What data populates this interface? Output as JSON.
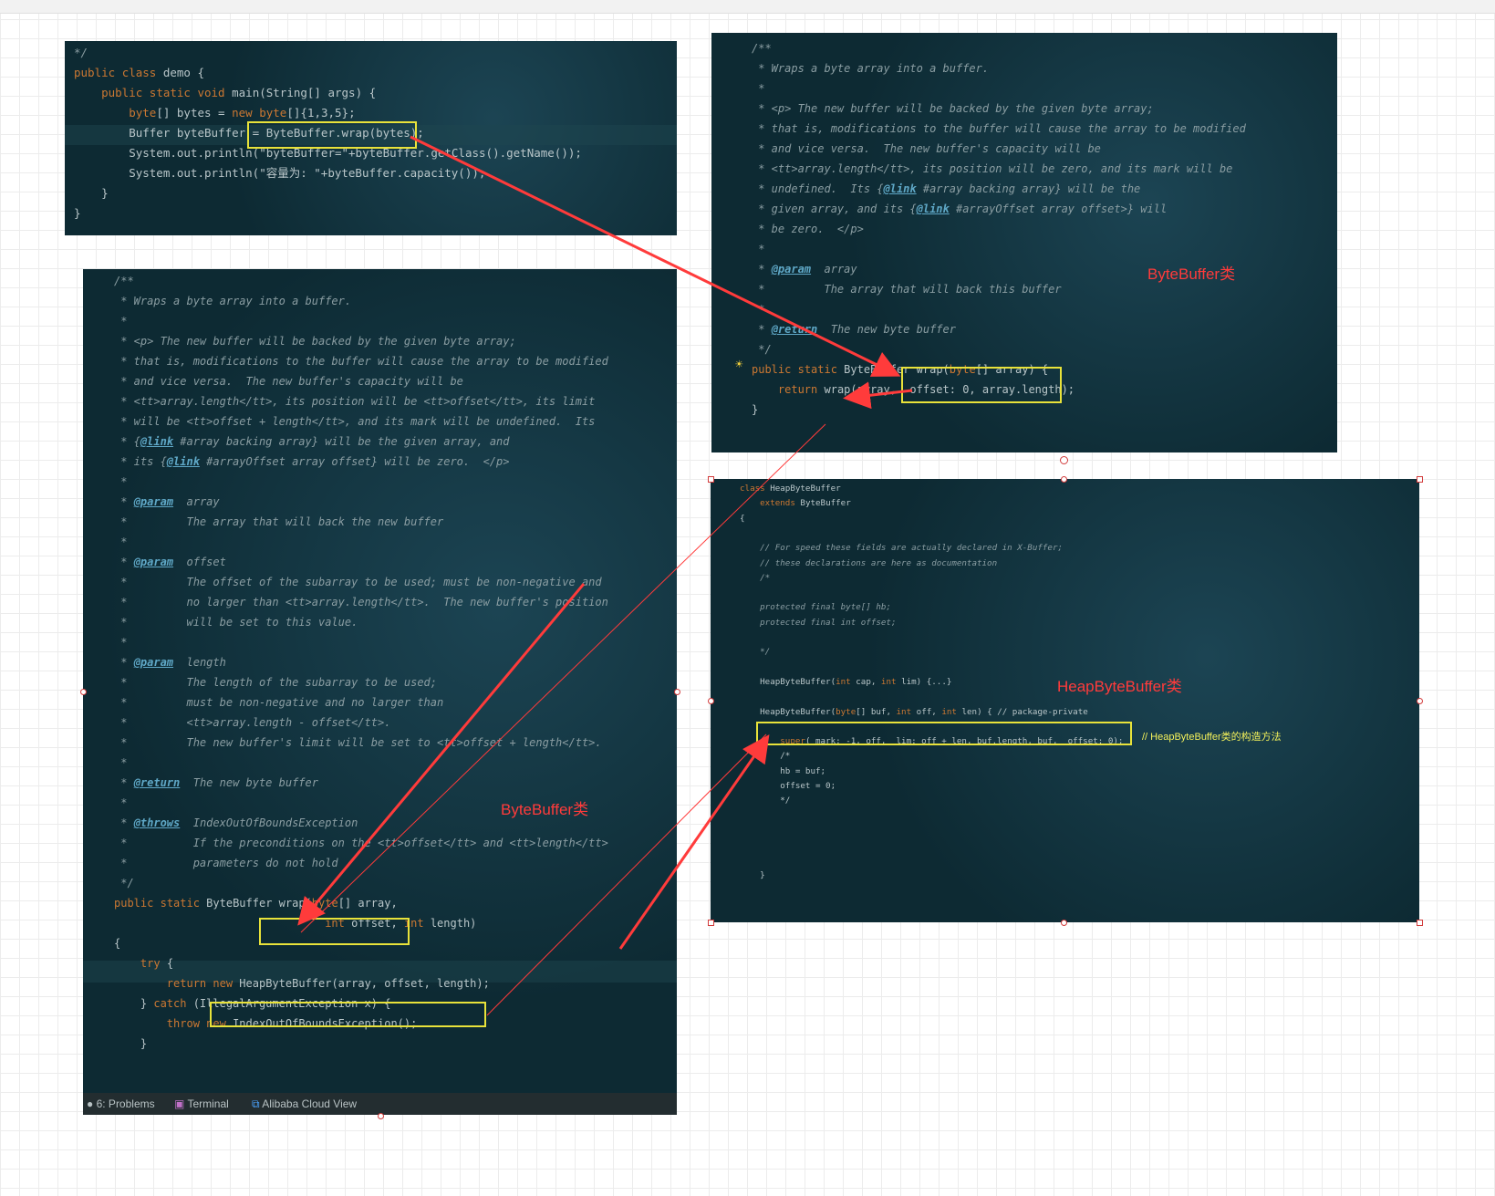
{
  "panel1": {
    "lines": [
      "*/",
      "public class demo {",
      "    public static void main(String[] args) {",
      "        byte[] bytes = new byte[]{1,3,5};",
      "        Buffer byteBuffer = ByteBuffer.wrap(bytes);",
      "        System.out.println(\"byteBuffer=\"+byteBuffer.getClass().getName());",
      "        System.out.println(\"容量为: \"+byteBuffer.capacity());",
      "    }",
      "}"
    ]
  },
  "panel2": {
    "lines": [
      "/**",
      " * Wraps a byte array into a buffer.",
      " *",
      " * <p> The new buffer will be backed by the given byte array;",
      " * that is, modifications to the buffer will cause the array to be modified",
      " * and vice versa.  The new buffer's capacity will be",
      " * <tt>array.length</tt>, its position will be zero, and its mark will be",
      " * undefined.  Its {@link #array backing array} will be the",
      " * given array, and its {@link #arrayOffset array offset>} will",
      " * be zero.  </p>",
      " *",
      " * @param  array",
      " *         The array that will back this buffer",
      " *",
      " * @return  The new byte buffer",
      " */",
      "public static ByteBuffer wrap(byte[] array) {",
      "    return wrap(array,  offset: 0, array.length);",
      "}"
    ],
    "label": "ByteBuffer类"
  },
  "panel3": {
    "lines": [
      "/**",
      " * Wraps a byte array into a buffer.",
      " *",
      " * <p> The new buffer will be backed by the given byte array;",
      " * that is, modifications to the buffer will cause the array to be modified",
      " * and vice versa.  The new buffer's capacity will be",
      " * <tt>array.length</tt>, its position will be <tt>offset</tt>, its limit",
      " * will be <tt>offset + length</tt>, and its mark will be undefined.  Its",
      " * {@link #array backing array} will be the given array, and",
      " * its {@link #arrayOffset array offset} will be zero.  </p>",
      " *",
      " * @param  array",
      " *         The array that will back the new buffer",
      " *",
      " * @param  offset",
      " *         The offset of the subarray to be used; must be non-negative and",
      " *         no larger than <tt>array.length</tt>.  The new buffer's position",
      " *         will be set to this value.",
      " *",
      " * @param  length",
      " *         The length of the subarray to be used;",
      " *         must be non-negative and no larger than",
      " *         <tt>array.length - offset</tt>.",
      " *         The new buffer's limit will be set to <tt>offset + length</tt>.",
      " *",
      " * @return  The new byte buffer",
      " *",
      " * @throws  IndexOutOfBoundsException",
      " *          If the preconditions on the <tt>offset</tt> and <tt>length</tt>",
      " *          parameters do not hold",
      " */",
      "public static ByteBuffer wrap(byte[] array,",
      "                                int offset, int length)",
      "{",
      "    try {",
      "        return new HeapByteBuffer(array, offset, length);",
      "    } catch (IllegalArgumentException x) {",
      "        throw new IndexOutOfBoundsException();",
      "    }"
    ],
    "label": "ByteBuffer类",
    "statusbar": {
      "problems": "6: Problems",
      "terminal": "Terminal",
      "cloud": "Alibaba Cloud View"
    }
  },
  "panel4": {
    "lines": [
      "class HeapByteBuffer",
      "    extends ByteBuffer",
      "{",
      "",
      "    // For speed these fields are actually declared in X-Buffer;",
      "    // these declarations are here as documentation",
      "    /*",
      "",
      "    protected final byte[] hb;",
      "    protected final int offset;",
      "",
      "    */",
      "",
      "    HeapByteBuffer(int cap, int lim) {...}",
      "",
      "    HeapByteBuffer(byte[] buf, int off, int len) { // package-private",
      "",
      "        super( mark: -1, off,  lim: off + len, buf.length, buf,  offset: 0);",
      "        /*",
      "        hb = buf;",
      "        offset = 0;",
      "        */",
      "",
      "",
      "",
      "",
      "    }"
    ],
    "label": "HeapByteBuffer类",
    "note": "// HeapByteBuffer类的构造方法"
  },
  "colors": {
    "panel_bg": "#0d2a33",
    "keyword": "#cc7832",
    "comment": "#8a9da2",
    "javadoc_tag": "#5fa8c7",
    "highlight_box": "#e8e23a",
    "arrow": "#ff3b3b",
    "label_red": "#ff3b3b"
  }
}
